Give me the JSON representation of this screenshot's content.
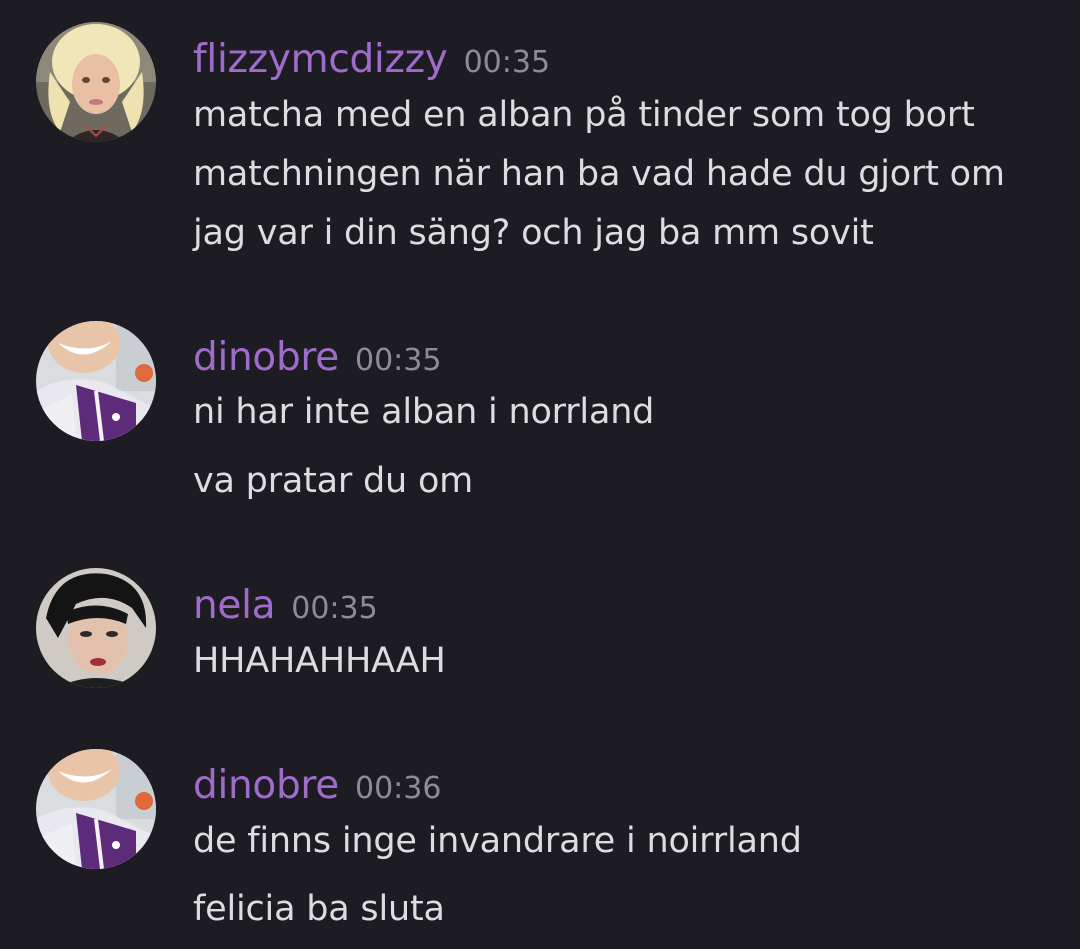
{
  "messages": [
    {
      "username": "flizzymcdizzy",
      "time": "00:35",
      "avatar": "blonde-person-avatar",
      "lines": [
        "matcha med en alban på tinder som tog bort",
        "matchningen när han ba vad hade du gjort om",
        "jag var i din säng? och jag ba mm sovit"
      ]
    },
    {
      "username": "dinobre",
      "time": "00:35",
      "avatar": "purple-jacket-person-avatar",
      "lines": [
        "ni har inte alban i norrland",
        "va pratar du om"
      ]
    },
    {
      "username": "nela",
      "time": "00:35",
      "avatar": "dark-haired-person-avatar",
      "lines": [
        "HHAHAHHAAH"
      ]
    },
    {
      "username": "dinobre",
      "time": "00:36",
      "avatar": "purple-jacket-person-avatar",
      "lines": [
        "de finns inge invandrare i noirrland",
        "felicia ba sluta"
      ]
    }
  ],
  "colors": {
    "background": "#1c1c22",
    "username": "#a06ccb",
    "timestamp": "#8a8c96",
    "text": "#dcdde1"
  }
}
